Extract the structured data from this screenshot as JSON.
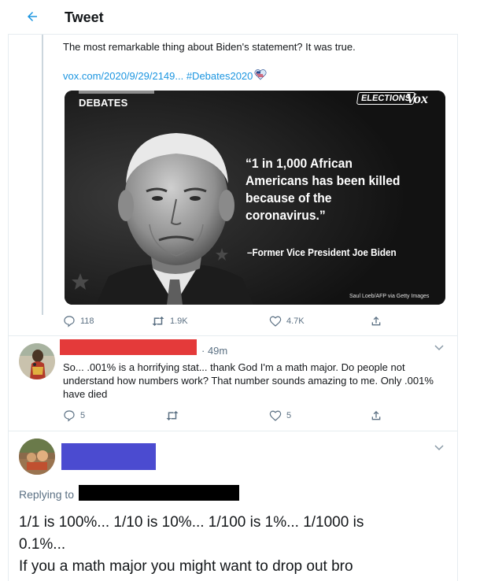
{
  "header": {
    "title": "Tweet"
  },
  "main_tweet": {
    "text": "The most remarkable thing about Biden's statement? It was true.",
    "link": "vox.com/2020/9/29/2149... #Debates2020",
    "media": {
      "label_top": "DEBATES",
      "elections_badge": "ELECTIONS",
      "brand": "Vox",
      "quote": "“1 in 1,000 African Americans has been killed because of the coronavirus.”",
      "attribution": "–Former Vice President Joe Biden",
      "credit": "Saul Loeb/AFP via Getty Images"
    },
    "actions": {
      "replies": "118",
      "retweets": "1.9K",
      "likes": "4.7K"
    }
  },
  "reply_1": {
    "time": "49m",
    "text": "So... .001% is a horrifying stat... thank God I'm a math major. Do people not understand how numbers work? That number sounds amazing to me. Only .001% have died",
    "actions": {
      "replies": "5",
      "retweets": "",
      "likes": "5"
    }
  },
  "reply_2": {
    "replying_to_label": "Replying to",
    "line1": "1/1 is 100%... 1/10 is 10%... 1/100 is 1%... 1/1000 is",
    "line2": "0.1%...",
    "line3": "If you a math major you might want to drop out bro"
  },
  "colors": {
    "accent": "#1b95e0",
    "redaction_red": "#e43a3a",
    "redaction_blue": "#4b4bd0",
    "redaction_black": "#000000"
  },
  "icons": [
    "back-arrow-icon",
    "reply-icon",
    "retweet-icon",
    "like-icon",
    "share-icon",
    "chevron-down-icon",
    "flag-heart-emoji-icon"
  ]
}
